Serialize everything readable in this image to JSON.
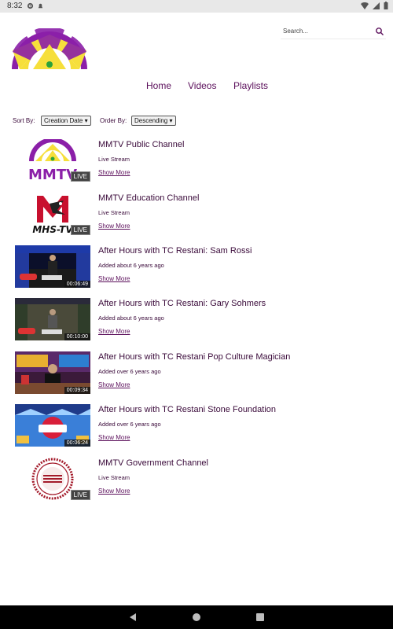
{
  "status_bar": {
    "time": "8:32",
    "left_icons": [
      "gear-icon",
      "notification-icon"
    ],
    "right_icons": [
      "wifi-icon",
      "signal-icon",
      "battery-icon"
    ]
  },
  "brand": {
    "logo": "mmtv-logo",
    "colors": {
      "purple": "#8b1fa8",
      "yellow": "#f6df3b",
      "green": "#2aa23a"
    }
  },
  "search": {
    "placeholder": "Search...",
    "icon": "search-icon"
  },
  "nav": {
    "items": [
      {
        "label": "Home"
      },
      {
        "label": "Videos"
      },
      {
        "label": "Playlists"
      }
    ]
  },
  "sort": {
    "sort_label": "Sort By:",
    "sort_value": "Creation Date",
    "order_label": "Order By:",
    "order_value": "Descending"
  },
  "items": [
    {
      "title": "MMTV Public Channel",
      "subtitle": "Live Stream",
      "more": "Show More",
      "badge": "LIVE",
      "thumb": "mmtv-logo-thumb"
    },
    {
      "title": "MMTV Education Channel",
      "subtitle": "Live Stream",
      "more": "Show More",
      "badge": "LIVE",
      "thumb": "mhs-tv-logo-thumb"
    },
    {
      "title": "After Hours with TC Restani: Sam Rossi",
      "subtitle": "Added about 6 years ago",
      "more": "Show More",
      "badge": "00:06:49",
      "thumb": "talk-show-stage-thumb"
    },
    {
      "title": "After Hours with TC Restani: Gary Sohmers",
      "subtitle": "Added about 6 years ago",
      "more": "Show More",
      "badge": "00:10:00",
      "thumb": "talk-show-stage-thumb"
    },
    {
      "title": "After Hours with TC Restani Pop Culture Magician",
      "subtitle": "Added over 6 years ago",
      "more": "Show More",
      "badge": "00:09:34",
      "thumb": "desk-interview-thumb"
    },
    {
      "title": "After Hours with TC Restani Stone Foundation",
      "subtitle": "Added over 6 years ago",
      "more": "Show More",
      "badge": "00:06:24",
      "thumb": "show-title-card-thumb"
    },
    {
      "title": "MMTV Government Channel",
      "subtitle": "Live Stream",
      "more": "Show More",
      "badge": "LIVE",
      "thumb": "city-seal-thumb"
    }
  ],
  "android_nav": {
    "icons": [
      "back-icon",
      "home-icon",
      "recents-icon"
    ]
  }
}
